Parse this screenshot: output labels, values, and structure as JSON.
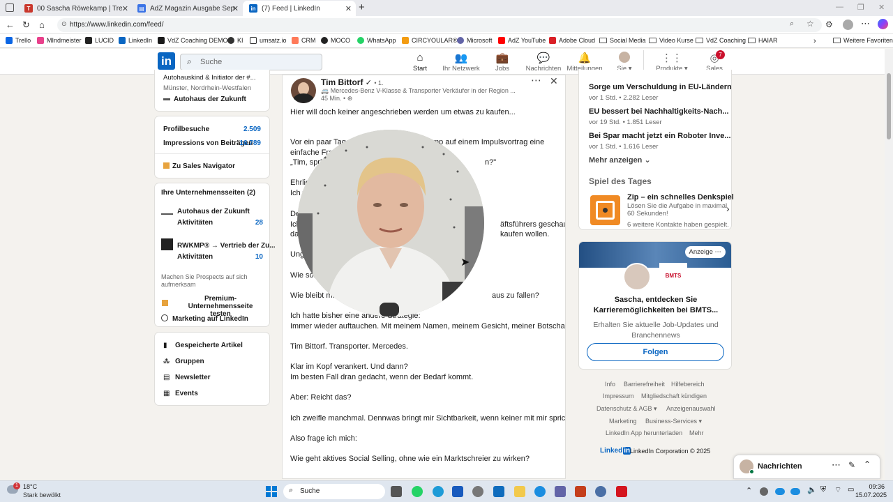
{
  "browser": {
    "tabs": [
      {
        "title": "00 Sascha Röwekamp | Trello",
        "icon_color": "#c9372c",
        "icon": "trello-icon"
      },
      {
        "title": "AdZ Magazin Ausgabe September",
        "icon_color": "#3b73e6",
        "icon": "doc-icon"
      },
      {
        "title": "(7) Feed | LinkedIn",
        "icon_color": "#0a66c2",
        "icon": "linkedin-icon"
      }
    ],
    "url": "https://www.linkedin.com/feed/",
    "bookmarks": [
      "Trello",
      "MIndmeister",
      "LUCID",
      "LinkedIn",
      "VdZ Coaching DEMO",
      "KI",
      "umsatz.io",
      "CRM",
      "MOCO",
      "WhatsApp",
      "CIRCYOULAR®",
      "Microsoft",
      "AdZ YouTube",
      "Adobe Cloud",
      "Social Media",
      "Video Kurse",
      "VdZ Coaching",
      "HAIAR"
    ],
    "other_favorites": "Weitere Favoriten"
  },
  "header": {
    "logo": "in",
    "search_placeholder": "Suche",
    "nav": [
      {
        "label": "Start",
        "icon": "home-icon",
        "active": true
      },
      {
        "label": "Ihr Netzwerk",
        "icon": "network-icon"
      },
      {
        "label": "Jobs",
        "icon": "briefcase-icon"
      },
      {
        "label": "Nachrichten",
        "icon": "message-icon"
      },
      {
        "label": "Mitteilungen",
        "icon": "bell-icon"
      },
      {
        "label": "Sie",
        "icon": "avatar"
      },
      {
        "label": "Produkte",
        "icon": "grid-icon"
      },
      {
        "label": "Sales Navigator",
        "icon": "compass-icon",
        "badge": "7"
      }
    ]
  },
  "left": {
    "profile_headline": "Autohauskind & Initiator der #...",
    "profile_location": "Münster, Nordrhein-Westfalen",
    "profile_company": "Autohaus der Zukunft",
    "stats": [
      {
        "label": "Profilbesuche",
        "value": "2.509"
      },
      {
        "label": "Impressions von Beiträgen",
        "value": "16.789"
      }
    ],
    "sales_nav": "Zu Sales Navigator",
    "pages_title": "Ihre Unternehmensseiten (2)",
    "pages": [
      {
        "name": "Autohaus der Zukunft",
        "activity_label": "Aktivitäten",
        "count": "28"
      },
      {
        "name": "RWKMP® → Vertrieb der Zu...",
        "activity_label": "Aktivitäten",
        "count": "10"
      }
    ],
    "prospects_text": "Machen Sie Prospects auf sich aufmerksam",
    "premium": "Premium-Unternehmensseite testen",
    "marketing": "Marketing auf LinkedIn",
    "links": [
      "Gespeicherte Artikel",
      "Gruppen",
      "Newsletter",
      "Events"
    ]
  },
  "post": {
    "author": "Tim Bittorf",
    "degree": "• 1.",
    "headline": "Mercedes-Benz V-Klasse & Transporter Verkäufer in der Region ...",
    "time": "45 Min. •",
    "lines": [
      "Hier will doch keiner angeschrieben werden um etwas zu kaufen...",
      "",
      "Vor ein paar Tagen",
      "einfache Frag",
      "„Tim, spri",
      "",
      "Ehrlic",
      "Ich w",
      "",
      "De",
      "Ich",
      "da",
      "",
      "Ung",
      "",
      "Wie sol",
      "",
      "Wie bleibt ma",
      "",
      "Ich hatte bisher eine andere Strategie:",
      "Immer wieder auftauchen. Mit meinem Namen, meinem Gesicht, meiner Botschaft:",
      "",
      "Tim Bittorf. Transporter. Mercedes.",
      "",
      "Klar im Kopf verankert. Und dann?",
      "Im besten Fall dran gedacht, wenn der Bedarf kommt.",
      "",
      "Aber: Reicht das?",
      "",
      "Ich zweifle manchmal. Dennwas bringt mir Sichtbarkeit, wenn keiner mit mir spricht?",
      "",
      "Also frage ich mich:",
      "",
      "Wie geht aktives Social Selling, ohne wie ein Marktschreier zu wirken?"
    ],
    "right_fragments": [
      {
        "text": "mp auf einem Impulsvortrag eine"
      },
      {
        "text": "n?\""
      },
      {
        "text": "äftsführers geschaut –"
      },
      {
        "text": "kaufen wollen."
      },
      {
        "text": "aus zu fallen?"
      }
    ]
  },
  "right": {
    "news": [
      {
        "title": "Sorge um Verschuldung in EU-Ländern",
        "meta": "vor 1 Std. • 2.282 Leser"
      },
      {
        "title": "EU bessert bei Nachhaltigkeits-Nach...",
        "meta": "vor 19 Std. • 1.851 Leser"
      },
      {
        "title": "Bei Spar macht jetzt ein Roboter Inve...",
        "meta": "vor 1 Std. • 1.616 Leser"
      }
    ],
    "more": "Mehr anzeigen",
    "game_section": "Spiel des Tages",
    "game_title": "Zip – ein schnelles Denkspiel",
    "game_desc1": "Lösen Sie die Aufgabe in maximal",
    "game_desc2": "60 Sekunden!",
    "game_contacts": "6 weitere Kontakte haben gespielt.",
    "ad_label": "Anzeige",
    "ad_company": "BMTS",
    "ad_title1": "Sascha, entdecken Sie",
    "ad_title2": "Karrieremöglichkeiten bei BMTS...",
    "ad_sub1": "Erhalten Sie aktuelle Job-Updates und",
    "ad_sub2": "Branchennews",
    "follow": "Folgen",
    "footer": {
      "row1": [
        "Info",
        "Barrierefreiheit",
        "Hilfebereich"
      ],
      "row2": [
        "Impressum",
        "Mitgliedschaft kündigen"
      ],
      "row3": [
        "Datenschutz & AGB ▾",
        "Anzeigenauswahl"
      ],
      "row4": [
        "Marketing",
        "Business-Services ▾"
      ],
      "row5": [
        "LinkedIn App herunterladen",
        "Mehr"
      ],
      "brand": "Linked",
      "corp": "LinkedIn Corporation © 2025"
    }
  },
  "messaging": {
    "title": "Nachrichten"
  },
  "taskbar": {
    "weather_temp": "18°C",
    "weather_desc": "Stark bewölkt",
    "search": "Suche",
    "time": "09:36",
    "date": "15.07.2025"
  }
}
